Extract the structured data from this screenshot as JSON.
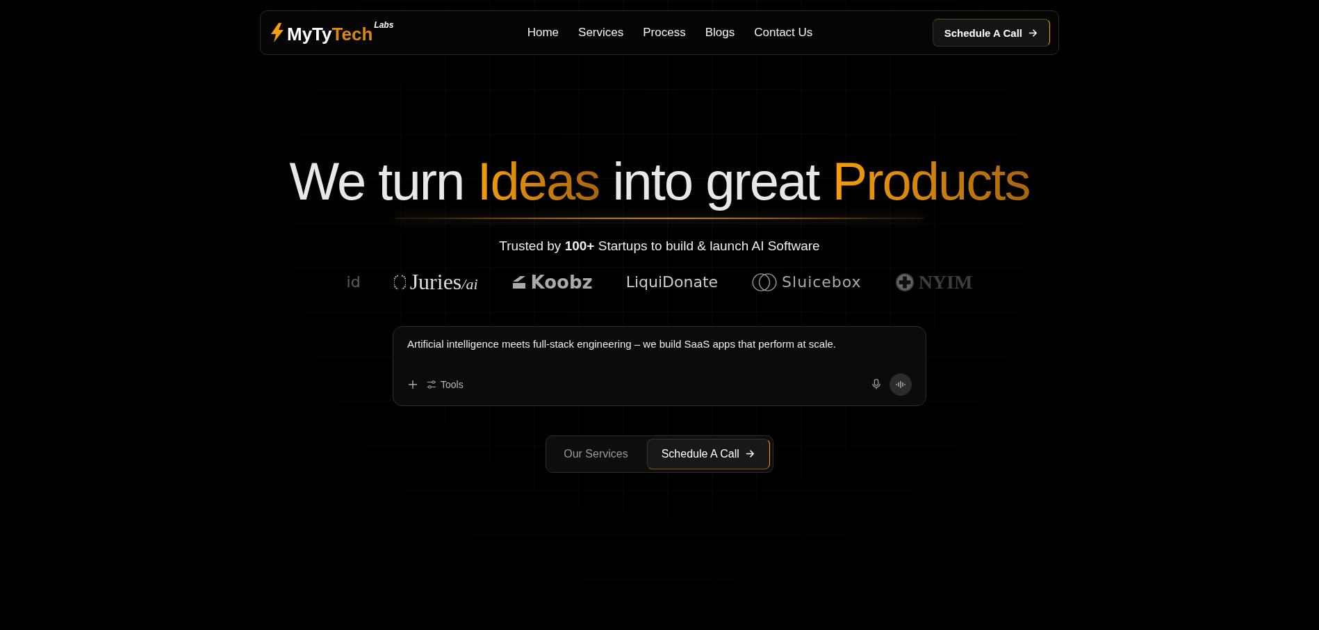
{
  "nav": {
    "logo": {
      "text": "MyTy",
      "accent": "Tech",
      "sup": "Labs"
    },
    "links": [
      {
        "label": "Home"
      },
      {
        "label": "Services"
      },
      {
        "label": "Process"
      },
      {
        "label": "Blogs"
      },
      {
        "label": "Contact Us"
      }
    ],
    "cta": "Schedule A Call"
  },
  "hero": {
    "title": [
      {
        "text": "We turn ",
        "accent": false
      },
      {
        "text": "Ideas",
        "accent": true
      },
      {
        "text": " into great ",
        "accent": false
      },
      {
        "text": "Products",
        "accent": true
      }
    ],
    "subtitle": "Trusted by **100+** Startups to build & launch AI Software"
  },
  "logos": [
    {
      "text": "id",
      "kind": "plain",
      "faded": true
    },
    {
      "text": "Juries",
      "suffix": "/ai",
      "kind": "bracket",
      "faded": false
    },
    {
      "text": "Koobz",
      "kind": "stripes",
      "faded": false
    },
    {
      "text": "LiquiDonate",
      "kind": "plain",
      "faded": false
    },
    {
      "text": "Sluicebox",
      "kind": "rings",
      "faded": false
    },
    {
      "text": "NYIM",
      "kind": "cross",
      "faded": true
    }
  ],
  "prompt": {
    "value": "Artificial intelligence meets full-stack engineering – we build SaaS apps that perform at scale.",
    "tools": "Tools"
  },
  "actions": [
    {
      "label": "Our Services",
      "selected": false
    },
    {
      "label": "Schedule A Call",
      "selected": true
    }
  ]
}
